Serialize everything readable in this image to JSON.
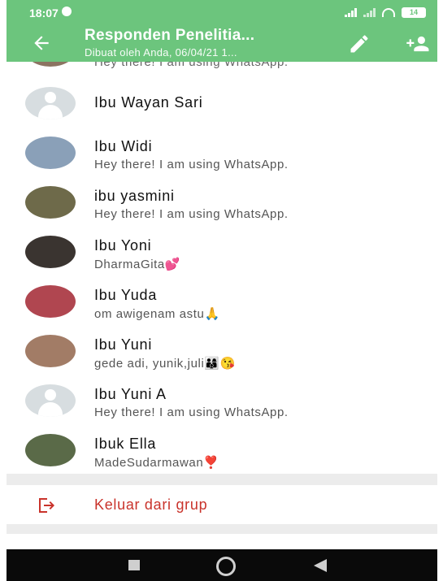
{
  "status_bar": {
    "time": "18:07",
    "battery": "14"
  },
  "header": {
    "title": "Responden Penelitia...",
    "subtitle": "Dibuat oleh Anda, 06/04/21 1..."
  },
  "partial_item": {
    "status": "Hey there! I am using WhatsApp."
  },
  "members": [
    {
      "name": "Ibu Wayan Sari",
      "status": "",
      "avatar": "placeholder"
    },
    {
      "name": "Ibu Widi",
      "status": "Hey there! I am using WhatsApp.",
      "avatar": "photo",
      "color": "#8aa0b8"
    },
    {
      "name": "ibu yasmini",
      "status": "Hey there! I am using WhatsApp.",
      "avatar": "photo",
      "color": "#6e6a4a"
    },
    {
      "name": "Ibu Yoni",
      "status": "DharmaGita💕",
      "avatar": "photo",
      "color": "#3a3430"
    },
    {
      "name": "Ibu Yuda",
      "status": "om awigenam astu🙏",
      "avatar": "photo",
      "color": "#b04650"
    },
    {
      "name": "Ibu Yuni",
      "status": "gede adi, yunik,juli👨‍👩‍👦😘",
      "avatar": "photo",
      "color": "#a27c66"
    },
    {
      "name": "Ibu Yuni A",
      "status": "Hey there! I am using WhatsApp.",
      "avatar": "placeholder"
    },
    {
      "name": "Ibuk Ella",
      "status": "MadeSudarmawan❣️",
      "avatar": "photo",
      "color": "#5a6a48"
    }
  ],
  "exit_group": {
    "label": "Keluar dari grup",
    "color": "#c9332b"
  },
  "theme": {
    "accent": "#6cc57d"
  }
}
